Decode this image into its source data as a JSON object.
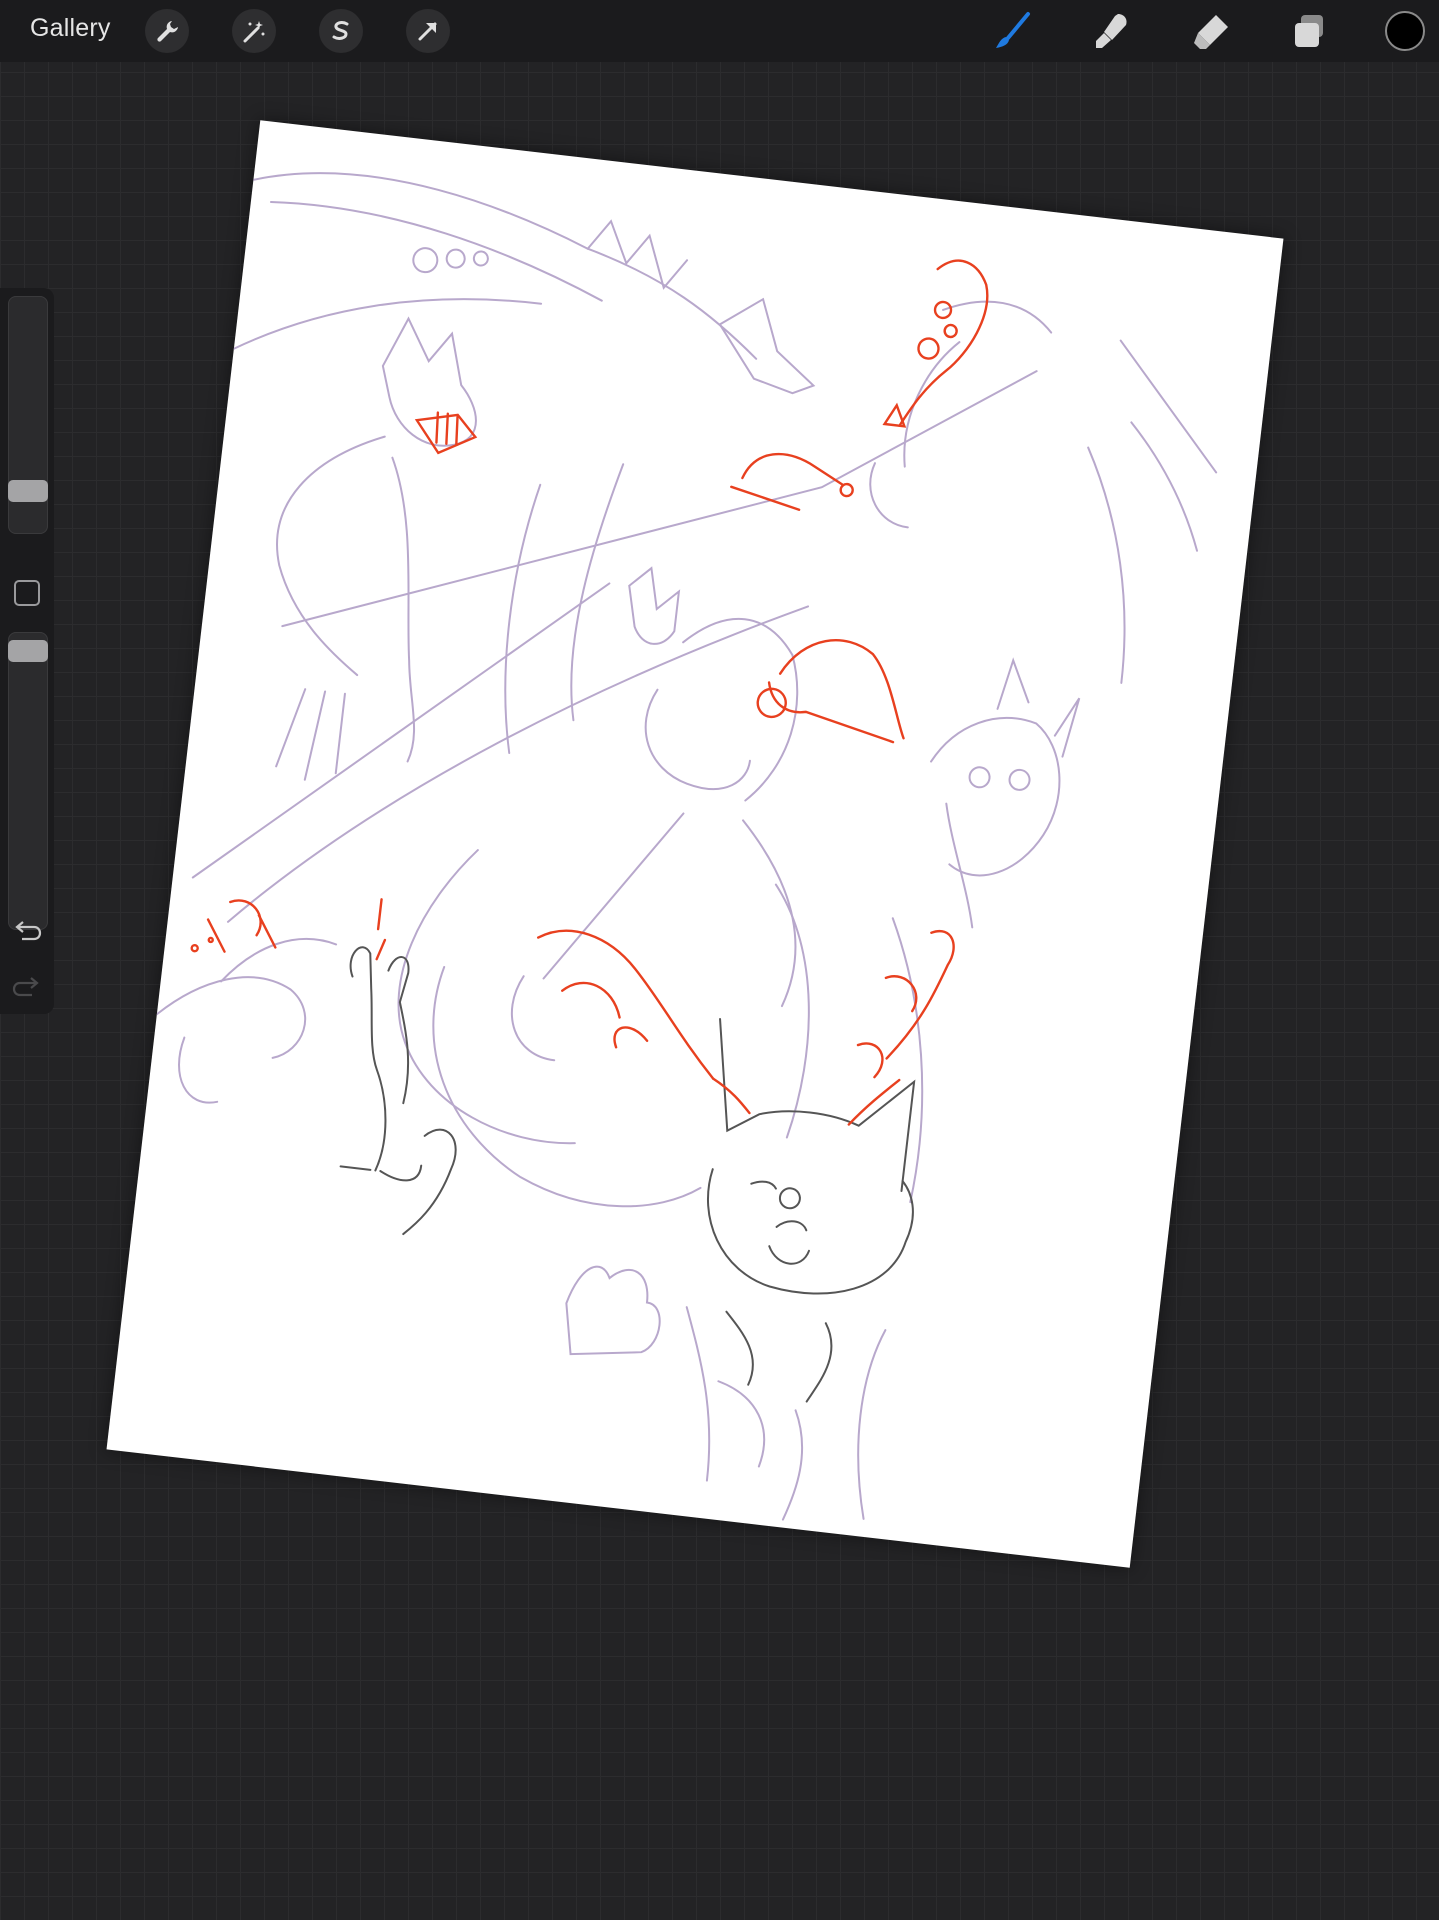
{
  "topbar": {
    "gallery_label": "Gallery",
    "left_tools": [
      "wrench-icon",
      "magic-wand-icon",
      "selection-icon",
      "transform-arrow-icon"
    ],
    "right_tools": [
      "brush-icon",
      "smudge-icon",
      "eraser-icon",
      "layers-icon"
    ],
    "active_tool": "brush",
    "active_color": "#000000",
    "active_tool_color": "#1f7ae0"
  },
  "sidebar": {
    "brush_size_level": 0.15,
    "opacity_level": 0.97,
    "undo_icon": "undo-icon",
    "redo_icon": "redo-icon"
  },
  "canvas": {
    "sketch_colors": {
      "lavender": "#b8a8cc",
      "red": "#e8401f",
      "gray": "#555555"
    }
  }
}
